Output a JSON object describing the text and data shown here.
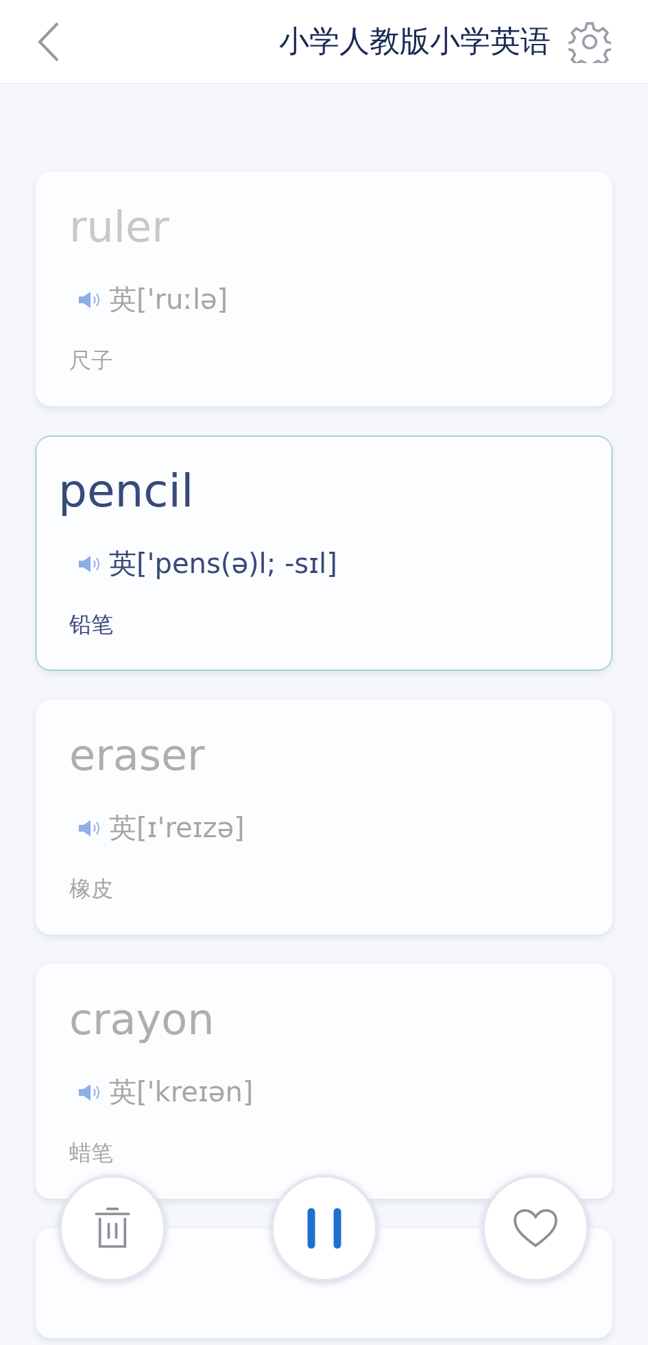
{
  "header": {
    "title": "小学人教版小学英语"
  },
  "cards": [
    {
      "word": "ruler",
      "phonetic": "英['ruːlə]",
      "meaning": "尺子",
      "selected": false
    },
    {
      "word": "pencil",
      "phonetic": "英['pens(ə)l; -sɪl]",
      "meaning": "铅笔",
      "selected": true
    },
    {
      "word": "eraser",
      "phonetic": "英[ɪ'reɪzə]",
      "meaning": "橡皮",
      "selected": false
    },
    {
      "word": "crayon",
      "phonetic": "英['kreɪən]",
      "meaning": "蜡笔",
      "selected": false
    }
  ],
  "controls": {
    "playing": true
  }
}
